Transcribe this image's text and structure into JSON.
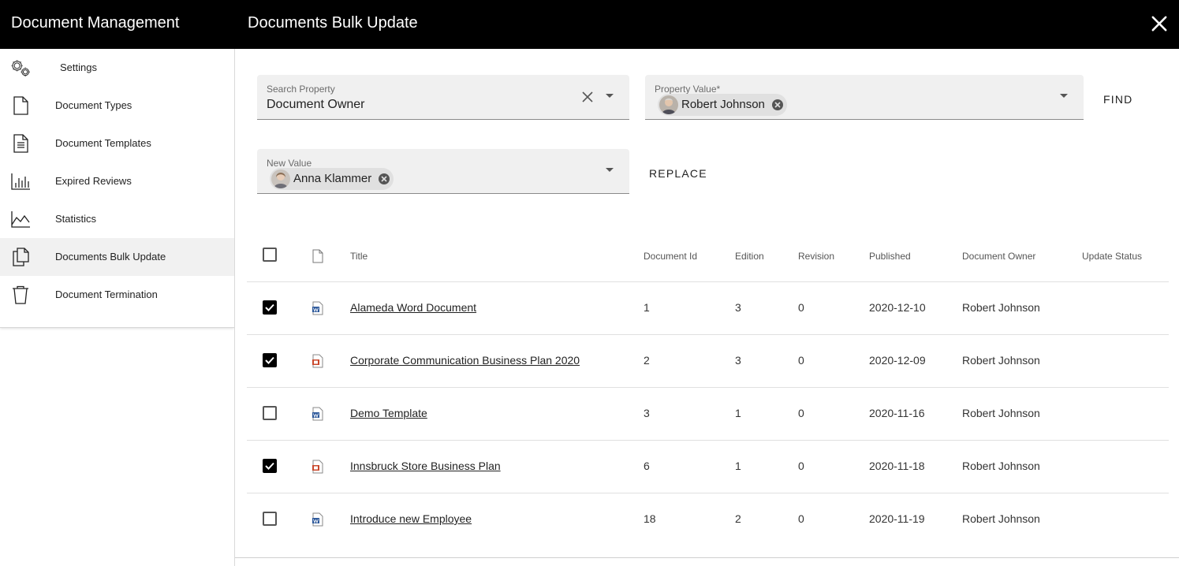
{
  "header": {
    "app_title": "Document Management",
    "panel_title": "Documents Bulk Update"
  },
  "sidebar": {
    "items": [
      {
        "label": "Settings",
        "icon": "gears-icon"
      },
      {
        "label": "Document Types",
        "icon": "document-icon"
      },
      {
        "label": "Document Templates",
        "icon": "document-lines-icon"
      },
      {
        "label": "Expired Reviews",
        "icon": "bar-chart-icon"
      },
      {
        "label": "Statistics",
        "icon": "area-chart-icon"
      },
      {
        "label": "Documents Bulk Update",
        "icon": "copy-documents-icon",
        "active": true
      },
      {
        "label": "Document Termination",
        "icon": "trash-icon"
      }
    ]
  },
  "search": {
    "property_label": "Search Property",
    "property_value": "Document Owner",
    "value_label": "Property Value*",
    "value_chip": "Robert Johnson",
    "find_label": "FIND"
  },
  "replace": {
    "new_value_label": "New Value",
    "new_value_chip": "Anna Klammer",
    "replace_label": "REPLACE"
  },
  "table": {
    "columns": [
      "Title",
      "Document Id",
      "Edition",
      "Revision",
      "Published",
      "Document Owner",
      "Update Status"
    ],
    "rows": [
      {
        "checked": true,
        "file_type": "word-file-icon",
        "title": "Alameda Word Document",
        "id": "1",
        "edition": "3",
        "revision": "0",
        "published": "2020-12-10",
        "owner": "Robert Johnson",
        "status": ""
      },
      {
        "checked": true,
        "file_type": "powerpoint-file-icon",
        "title": "Corporate Communication Business Plan 2020",
        "id": "2",
        "edition": "3",
        "revision": "0",
        "published": "2020-12-09",
        "owner": "Robert Johnson",
        "status": ""
      },
      {
        "checked": false,
        "file_type": "word-file-icon",
        "title": "Demo Template",
        "id": "3",
        "edition": "1",
        "revision": "0",
        "published": "2020-11-16",
        "owner": "Robert Johnson",
        "status": ""
      },
      {
        "checked": true,
        "file_type": "powerpoint-file-icon",
        "title": "Innsbruck Store Business Plan",
        "id": "6",
        "edition": "1",
        "revision": "0",
        "published": "2020-11-18",
        "owner": "Robert Johnson",
        "status": ""
      },
      {
        "checked": false,
        "file_type": "word-file-icon",
        "title": "Introduce new Employee",
        "id": "18",
        "edition": "2",
        "revision": "0",
        "published": "2020-11-19",
        "owner": "Robert Johnson",
        "status": ""
      }
    ]
  },
  "colors": {
    "header_bg": "#000000",
    "active_nav_bg": "#f1f1f1",
    "word_blue": "#2b579a",
    "ppt_red": "#c9472b"
  }
}
